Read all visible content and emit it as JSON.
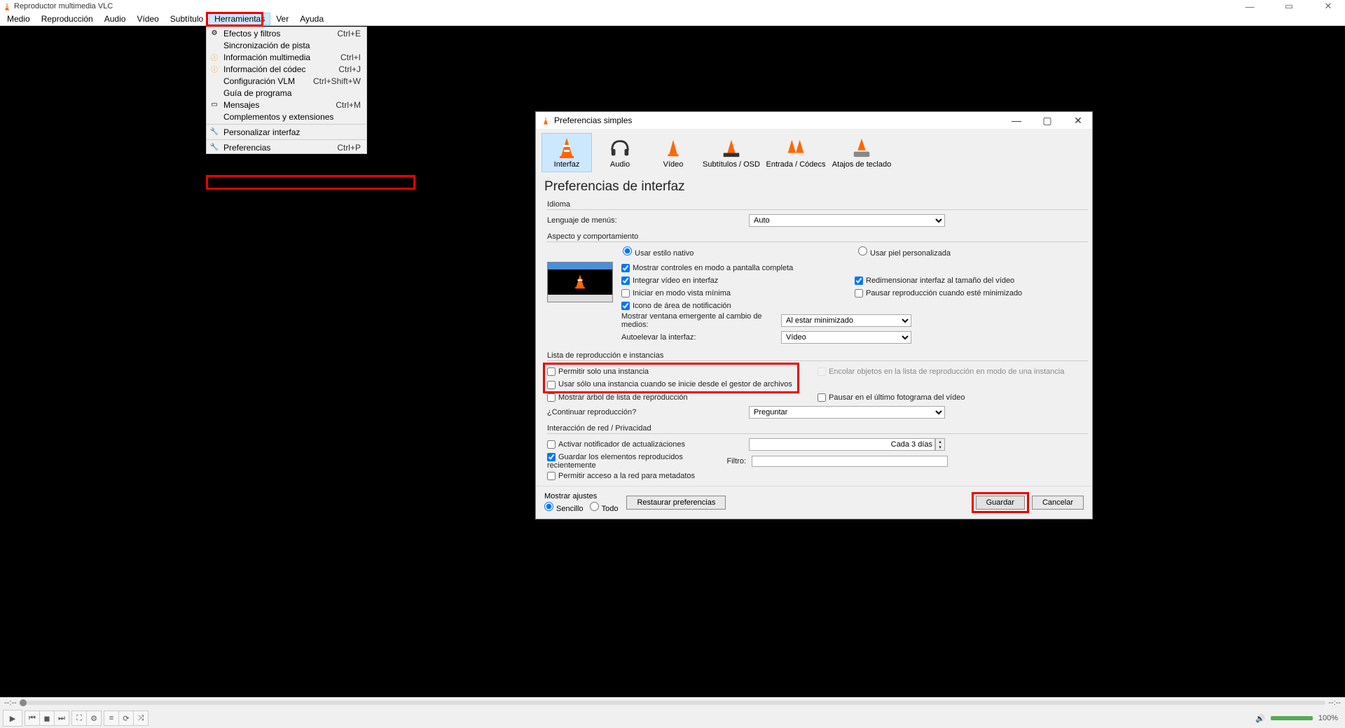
{
  "titlebar": {
    "title": "Reproductor multimedia VLC"
  },
  "menubar": {
    "items": [
      "Medio",
      "Reproducción",
      "Audio",
      "Vídeo",
      "Subtítulo",
      "Herramientas",
      "Ver",
      "Ayuda"
    ],
    "activeIndex": 5
  },
  "dropdown": {
    "items": [
      {
        "label": "Efectos y filtros",
        "shortcut": "Ctrl+E",
        "icon": "sliders"
      },
      {
        "label": "Sincronización de pista",
        "shortcut": "",
        "icon": ""
      },
      {
        "label": "Información multimedia",
        "shortcut": "Ctrl+I",
        "icon": "info"
      },
      {
        "label": "Información del códec",
        "shortcut": "Ctrl+J",
        "icon": "info"
      },
      {
        "label": "Configuración VLM",
        "shortcut": "Ctrl+Shift+W",
        "icon": ""
      },
      {
        "label": "Guía de programa",
        "shortcut": "",
        "icon": ""
      },
      {
        "label": "Mensajes",
        "shortcut": "Ctrl+M",
        "icon": "message"
      },
      {
        "label": "Complementos y extensiones",
        "shortcut": "",
        "icon": ""
      }
    ],
    "sep1": true,
    "items2": [
      {
        "label": "Personalizar interfaz",
        "shortcut": "",
        "icon": "wrench"
      }
    ],
    "sep2": true,
    "items3": [
      {
        "label": "Preferencias",
        "shortcut": "Ctrl+P",
        "icon": "wrench"
      }
    ]
  },
  "timeline": {
    "left": "--:--",
    "right": "--:--"
  },
  "volume": "100%",
  "dialog": {
    "title": "Preferencias simples",
    "categories": [
      "Interfaz",
      "Audio",
      "Vídeo",
      "Subtítulos / OSD",
      "Entrada / Códecs",
      "Atajos de teclado"
    ],
    "activeCat": 0,
    "prefsTitle": "Preferencias de interfaz",
    "sections": {
      "language": {
        "title": "Idioma",
        "menuLangLabel": "Lenguaje de menús:",
        "menuLangValue": "Auto"
      },
      "look": {
        "title": "Aspecto y comportamiento",
        "nativeStyle": "Usar estilo nativo",
        "customSkin": "Usar piel personalizada",
        "fullscreenCtrls": "Mostrar controles en modo a pantalla completa",
        "integrateVideo": "Integrar vídeo en interfaz",
        "resizeInterface": "Redimensionar interfaz al tamaño del vídeo",
        "startMinimal": "Iniciar en modo vista mínima",
        "pauseMinimized": "Pausar reproducción cuando esté minimizado",
        "trayIcon": "Icono de área de notificación",
        "popupLabel": "Mostrar ventana emergente al cambio de medios:",
        "popupValue": "Al estar minimizado",
        "autoRaiseLabel": "Autoelevar la interfaz:",
        "autoRaiseValue": "Vídeo"
      },
      "playlist": {
        "title": "Lista de reproducción e instancias",
        "oneInstance": "Permitir solo una instancia",
        "enqueue": "Encolar objetos en la lista de reproducción en modo de una instancia",
        "oneInstanceFM": "Usar sólo una instancia cuando se inicie desde el gestor de archivos",
        "showTree": "Mostrar árbol de lista de reproducción",
        "pauseLast": "Pausar en el último fotograma del vídeo",
        "continueLabel": "¿Continuar reproducción?",
        "continueValue": "Preguntar"
      },
      "network": {
        "title": "Interacción de red / Privacidad",
        "updateNotifier": "Activar notificador de actualizaciones",
        "updateEvery": "Cada 3 días",
        "saveRecent": "Guardar los elementos reproducidos recientemente",
        "filterLabel": "Filtro:",
        "allowMeta": "Permitir acceso a la red para metadatos"
      }
    },
    "bottom": {
      "showSettings": "Mostrar ajustes",
      "simple": "Sencillo",
      "all": "Todo",
      "reset": "Restaurar preferencias",
      "save": "Guardar",
      "cancel": "Cancelar"
    }
  }
}
